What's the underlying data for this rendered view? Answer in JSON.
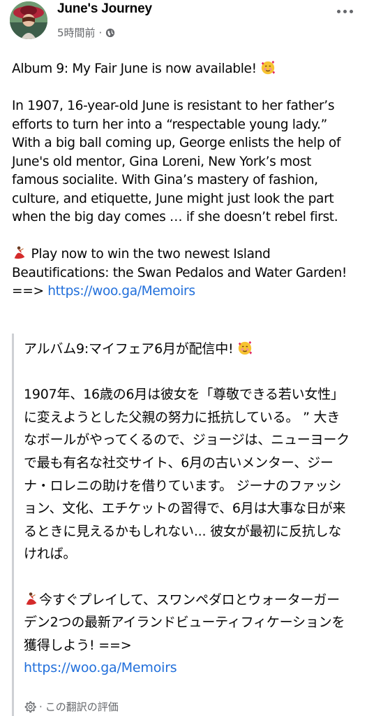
{
  "header": {
    "page_name": "June's Journey",
    "time": "5時間前",
    "separator": "·",
    "privacy_icon": "globe-icon",
    "more_icon": "more-dots-icon"
  },
  "post": {
    "title_line": "Album 9: My Fair June is now available!",
    "title_emoji": "smiling-face-with-hearts",
    "paragraph_1": "In 1907, 16-year-old June is resistant to her father’s efforts to turn her into a “respectable young lady.” With a big ball coming up, George enlists the help of June's old mentor, Gina Loreni, New York’s most famous socialite. With Gina’s mastery of fashion, culture, and etiquette, June might just look the part when the big day comes … if she doesn’t rebel first.",
    "cta_emoji": "dancer",
    "cta_text": " Play now to win the two newest Island Beautifications: the Swan Pedalos and Water Garden! ==> ",
    "link": "https://woo.ga/Memoirs"
  },
  "translation": {
    "title_line": "アルバム9:マイフェア6月が配信中!",
    "paragraph_1": "1907年、16歳の6月は彼女を「尊敬できる若い女性」に変えようとした父親の努力に抵抗している。 ” 大きなボールがやってくるので、ジョージは、ニューヨークで最も有名な社交サイト、6月の古いメンター、ジーナ・ロレニの助けを借りています。 ジーナのファッション、文化、エチケットの習得で、6月は大事な日が来るときに見えるかもしれない... 彼女が最初に反抗しなければ。",
    "cta_text": "今すぐプレイして、スワンペダロとウォーターガーデン2つの最新アイランドビューティフィケーションを獲得しよう! ==>",
    "link": "https://woo.ga/Memoirs",
    "rate_separator": "·",
    "rate_label": "この翻訳の評価"
  },
  "colors": {
    "link": "#216fdb",
    "meta_gray": "#65676b",
    "quote_bar": "#ced0d4"
  }
}
